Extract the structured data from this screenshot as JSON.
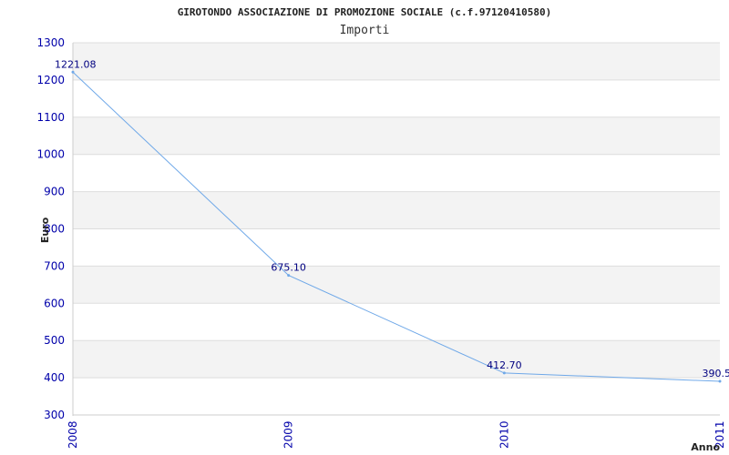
{
  "chart_data": {
    "type": "line",
    "title": "GIROTONDO ASSOCIAZIONE DI PROMOZIONE SOCIALE (c.f.97120410580)",
    "subtitle": "Importi",
    "xlabel": "Anno",
    "ylabel": "Euro",
    "categories": [
      "2008",
      "2009",
      "2010",
      "2011"
    ],
    "series": [
      {
        "values": [
          1221.08,
          675.1,
          412.7,
          390.5
        ]
      }
    ],
    "data_labels": [
      "1221.08",
      "675.10",
      "412.70",
      "390.5"
    ],
    "ylim": [
      300,
      1300
    ],
    "yticks": [
      300,
      400,
      500,
      600,
      700,
      800,
      900,
      1000,
      1100,
      1200,
      1300
    ],
    "grid": true,
    "line_color": "#6fa8e8",
    "band_color": "#f3f3f3",
    "tick_color": "#0000aa"
  }
}
